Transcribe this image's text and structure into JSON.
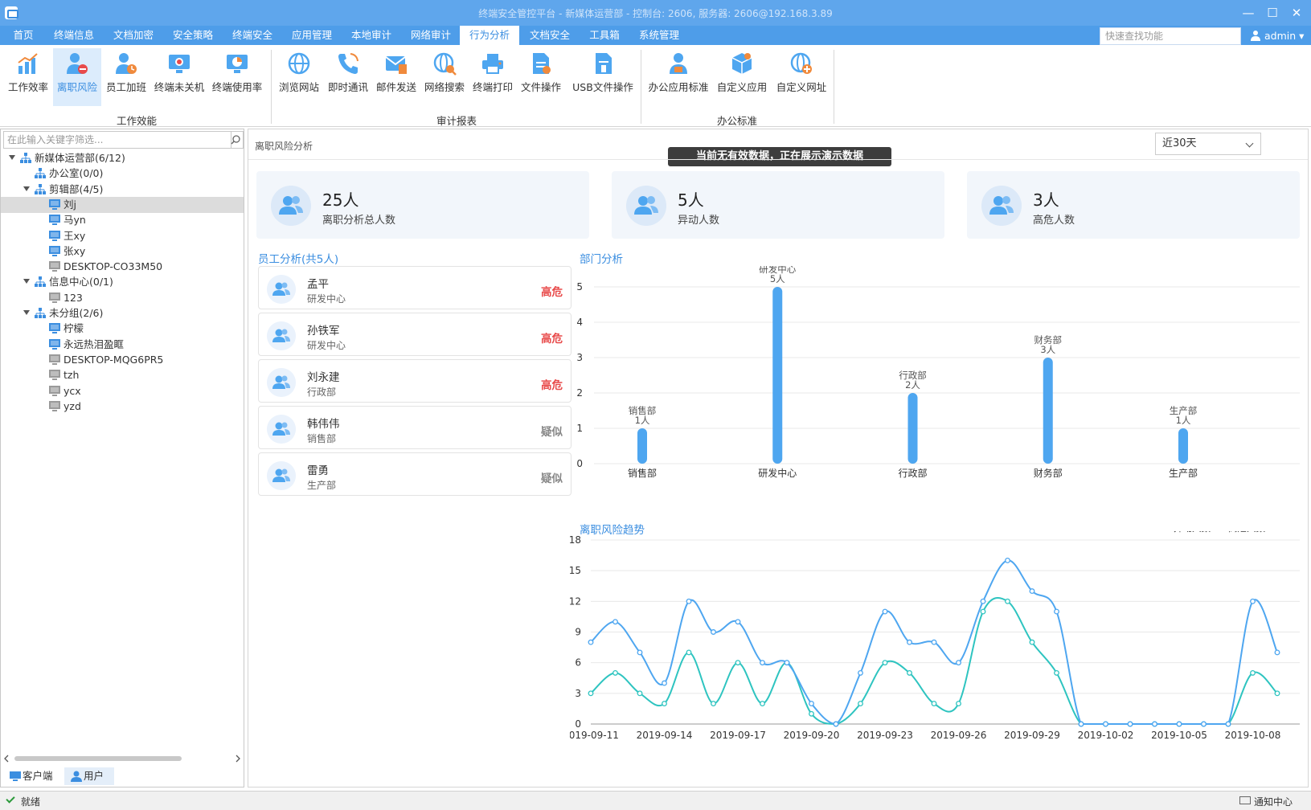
{
  "window": {
    "title": "终端安全管控平台 - 新媒体运营部 - 控制台: 2606, 服务器: 2606@192.168.3.89",
    "min_symbol": "—",
    "max_symbol": "☐",
    "close_symbol": "✕"
  },
  "menu": {
    "tabs": [
      {
        "label": "首页"
      },
      {
        "label": "终端信息"
      },
      {
        "label": "文档加密"
      },
      {
        "label": "安全策略"
      },
      {
        "label": "终端安全"
      },
      {
        "label": "应用管理"
      },
      {
        "label": "本地审计"
      },
      {
        "label": "网络审计"
      },
      {
        "label": "行为分析",
        "active": true
      },
      {
        "label": "文档安全"
      },
      {
        "label": "工具箱"
      },
      {
        "label": "系统管理"
      }
    ],
    "quick_search_placeholder": "快速查找功能",
    "user": "admin ▾"
  },
  "ribbon": {
    "groups": [
      {
        "label": "工作效能"
      },
      {
        "label": "审计报表"
      },
      {
        "label": "办公标准"
      }
    ],
    "buttons": [
      {
        "label": "工作效率",
        "icon": "efficiency-chart-icon"
      },
      {
        "label": "离职风险",
        "icon": "resign-risk-icon",
        "active": true
      },
      {
        "label": "员工加班",
        "icon": "overtime-icon"
      },
      {
        "label": "终端未关机",
        "icon": "terminal-not-off-icon"
      },
      {
        "label": "终端使用率",
        "icon": "terminal-usage-icon"
      },
      {
        "label": "浏览网站",
        "icon": "globe-icon"
      },
      {
        "label": "即时通讯",
        "icon": "phone-icon"
      },
      {
        "label": "邮件发送",
        "icon": "mail-icon"
      },
      {
        "label": "网络搜索",
        "icon": "web-search-icon"
      },
      {
        "label": "终端打印",
        "icon": "printer-icon"
      },
      {
        "label": "文件操作",
        "icon": "file-icon"
      },
      {
        "label": "USB文件操作",
        "icon": "usb-file-icon"
      },
      {
        "label": "办公应用标准",
        "icon": "office-app-icon"
      },
      {
        "label": "自定义应用",
        "icon": "custom-app-icon"
      },
      {
        "label": "自定义网址",
        "icon": "custom-url-icon"
      }
    ]
  },
  "left_panel": {
    "search_placeholder": "在此输入关键字筛选...",
    "tree": [
      {
        "label": "新媒体运营部(6/12)",
        "type": "org",
        "level": 0,
        "expanded": true
      },
      {
        "label": "办公室(0/0)",
        "type": "org",
        "level": 1
      },
      {
        "label": "剪辑部(4/5)",
        "type": "org",
        "level": 1,
        "expanded": true
      },
      {
        "label": "刘j",
        "type": "pc-online",
        "level": 2,
        "selected": true
      },
      {
        "label": "马yn",
        "type": "pc-online",
        "level": 2
      },
      {
        "label": "王xy",
        "type": "pc-online",
        "level": 2
      },
      {
        "label": "张xy",
        "type": "pc-online",
        "level": 2
      },
      {
        "label": "DESKTOP-CO33M50",
        "type": "pc-offline",
        "level": 2
      },
      {
        "label": "信息中心(0/1)",
        "type": "org",
        "level": 1,
        "expanded": true
      },
      {
        "label": "123",
        "type": "pc-offline",
        "level": 2
      },
      {
        "label": "未分组(2/6)",
        "type": "org",
        "level": 1,
        "expanded": true
      },
      {
        "label": "柠檬",
        "type": "pc-online",
        "level": 2
      },
      {
        "label": "永远热泪盈眶",
        "type": "pc-online",
        "level": 2
      },
      {
        "label": "DESKTOP-MQG6PR5",
        "type": "pc-offline",
        "level": 2
      },
      {
        "label": "tzh",
        "type": "pc-offline",
        "level": 2
      },
      {
        "label": "ycx",
        "type": "pc-offline",
        "level": 2
      },
      {
        "label": "yzd",
        "type": "pc-offline",
        "level": 2
      }
    ],
    "tabs": [
      {
        "label": "客户端"
      },
      {
        "label": "用户",
        "active": true
      }
    ]
  },
  "main": {
    "page_title": "离职风险分析",
    "demo_banner": "当前无有效数据，正在展示演示数据",
    "range_select": "近30天",
    "stats": [
      {
        "value": "25人",
        "label": "离职分析总人数"
      },
      {
        "value": "5人",
        "label": "异动人数"
      },
      {
        "value": "3人",
        "label": "高危人数"
      }
    ],
    "employee_title": "员工分析(共5人)",
    "employees": [
      {
        "name": "孟平",
        "dept": "研发中心",
        "risk": "高危"
      },
      {
        "name": "孙铁军",
        "dept": "研发中心",
        "risk": "高危"
      },
      {
        "name": "刘永建",
        "dept": "行政部",
        "risk": "高危"
      },
      {
        "name": "韩伟伟",
        "dept": "销售部",
        "risk": "疑似"
      },
      {
        "name": "雷勇",
        "dept": "生产部",
        "risk": "疑似"
      }
    ],
    "dept_title": "部门分析",
    "trend_title": "离职风险趋势"
  },
  "colors": {
    "accent": "#3b8ee0",
    "high_risk": "#e84a4a",
    "suspect": "#888888",
    "bar": "#4ea6f0",
    "line_move": "#4ea6f0",
    "line_high": "#2ec4c0"
  },
  "chart_data": [
    {
      "type": "bar",
      "title": "部门分析",
      "categories": [
        "销售部",
        "研发中心",
        "行政部",
        "财务部",
        "生产部"
      ],
      "values": [
        1,
        5,
        2,
        3,
        1
      ],
      "data_labels": [
        "1人",
        "5人",
        "2人",
        "3人",
        "1人"
      ],
      "ylim": [
        0,
        5
      ],
      "yticks": [
        0,
        1,
        2,
        3,
        4,
        5
      ],
      "grid": true
    },
    {
      "type": "line",
      "title": "离职风险趋势",
      "x": [
        "2019-09-11",
        "2019-09-12",
        "2019-09-13",
        "2019-09-14",
        "2019-09-15",
        "2019-09-16",
        "2019-09-17",
        "2019-09-18",
        "2019-09-19",
        "2019-09-20",
        "2019-09-21",
        "2019-09-22",
        "2019-09-23",
        "2019-09-24",
        "2019-09-25",
        "2019-09-26",
        "2019-09-27",
        "2019-09-28",
        "2019-09-29",
        "2019-09-30",
        "2019-10-01",
        "2019-10-02",
        "2019-10-03",
        "2019-10-04",
        "2019-10-05",
        "2019-10-06",
        "2019-10-07",
        "2019-10-08",
        "2019-10-09"
      ],
      "xticks": [
        "2019-09-11",
        "2019-09-14",
        "2019-09-17",
        "2019-09-20",
        "2019-09-23",
        "2019-09-26",
        "2019-09-29",
        "2019-10-02",
        "2019-10-05",
        "2019-10-08"
      ],
      "series": [
        {
          "name": "异动人数",
          "values": [
            8,
            10,
            7,
            4,
            12,
            9,
            10,
            6,
            6,
            2,
            0,
            5,
            11,
            8,
            8,
            6,
            12,
            16,
            13,
            11,
            0,
            0,
            0,
            0,
            0,
            0,
            0,
            12,
            7
          ]
        },
        {
          "name": "高危人数",
          "values": [
            3,
            5,
            3,
            2,
            7,
            2,
            6,
            2,
            6,
            1,
            0,
            2,
            6,
            5,
            2,
            2,
            11,
            12,
            8,
            5,
            0,
            0,
            0,
            0,
            0,
            0,
            0,
            5,
            3
          ]
        }
      ],
      "ylim": [
        0,
        18
      ],
      "yticks": [
        0,
        3,
        6,
        9,
        12,
        15,
        18
      ],
      "legend": "top-right",
      "grid": true
    }
  ],
  "status_bar": {
    "status": "就绪",
    "notify": "通知中心"
  }
}
